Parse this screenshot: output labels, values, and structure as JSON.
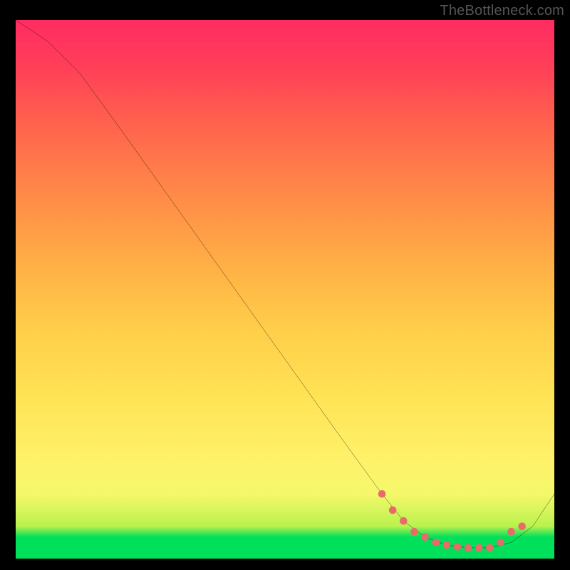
{
  "watermark": "TheBottleneck.com",
  "chart_data": {
    "type": "line",
    "title": "",
    "xlabel": "",
    "ylabel": "",
    "xlim": [
      0,
      100
    ],
    "ylim": [
      0,
      100
    ],
    "grid": false,
    "legend": false,
    "line": {
      "name": "bottleneck-curve",
      "color": "#000000",
      "x": [
        0,
        6,
        12,
        20,
        30,
        40,
        50,
        60,
        68,
        72,
        76,
        80,
        84,
        88,
        92,
        96,
        100
      ],
      "y": [
        100,
        96,
        90,
        79,
        65,
        51,
        37,
        23,
        12,
        7,
        4,
        2.5,
        2,
        2,
        3,
        6,
        12
      ]
    },
    "valley_markers": {
      "name": "valley-dots",
      "color": "#e86a6a",
      "x": [
        68,
        70,
        72,
        74,
        76,
        78,
        80,
        82,
        84,
        86,
        88,
        90,
        92,
        94
      ],
      "y": [
        12,
        9,
        7,
        5,
        4,
        3,
        2.5,
        2.2,
        2,
        2,
        2,
        3,
        5,
        6
      ]
    },
    "gradient_stops": [
      {
        "pos": 0,
        "color": "#00e05a"
      },
      {
        "pos": 4,
        "color": "#00e05a"
      },
      {
        "pos": 6,
        "color": "#b9f24e"
      },
      {
        "pos": 12,
        "color": "#f5f86a"
      },
      {
        "pos": 30,
        "color": "#ffe355"
      },
      {
        "pos": 52,
        "color": "#ffb646"
      },
      {
        "pos": 72,
        "color": "#ff7d4a"
      },
      {
        "pos": 92,
        "color": "#ff3d59"
      },
      {
        "pos": 100,
        "color": "#ff2c62"
      }
    ]
  }
}
